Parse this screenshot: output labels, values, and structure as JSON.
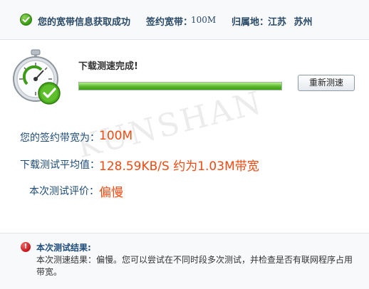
{
  "header": {
    "status_text": "您的宽带信息获取成功",
    "bandwidth_label": "签约宽带：",
    "bandwidth_value": "100M",
    "location_label": "归属地：",
    "location_value": "江苏 苏州"
  },
  "test": {
    "title": "下载测速完成!",
    "progress_percent": 100,
    "retest_button": "重新测速"
  },
  "watermark": "KUNSHAN",
  "results": {
    "contract_label": "您的签约带宽为：",
    "contract_value": "100M",
    "avg_label": "下载测试平均值：",
    "avg_value": "128.59KB/S 约为1.03M带宽",
    "rating_label": "本次测试评价：",
    "rating_value": "偏慢"
  },
  "summary": {
    "title": "本次测试结果:",
    "text": "本次测速结果：偏慢。您可以尝试在不同时段多次测试，并检查是否有联网程序占用带宽。"
  },
  "colors": {
    "accent_value": "#ee4a12",
    "label_blue": "#1e4c7a",
    "progress_green": "#58b72a"
  }
}
